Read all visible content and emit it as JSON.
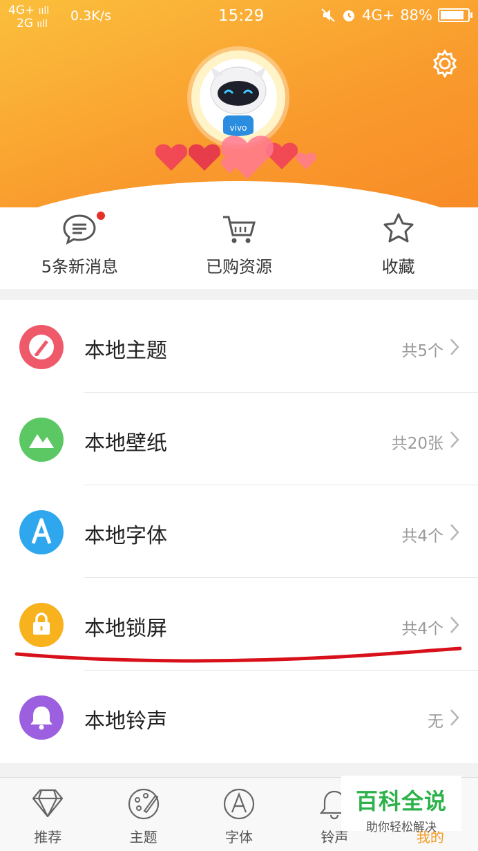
{
  "status_bar": {
    "signal_1": "4G+",
    "signal_2": "2G",
    "speed": "0.3K/s",
    "time": "15:29",
    "network": "4G+",
    "battery_text": "88%",
    "battery_level": 0.88
  },
  "header": {
    "avatar_text": "vivo"
  },
  "quick_actions": [
    {
      "label": "5条新消息"
    },
    {
      "label": "已购资源"
    },
    {
      "label": "收藏"
    }
  ],
  "local_items": [
    {
      "title": "本地主题",
      "count": "共5个",
      "color": "#ef5a6a"
    },
    {
      "title": "本地壁纸",
      "count": "共20张",
      "color": "#5cc864"
    },
    {
      "title": "本地字体",
      "count": "共4个",
      "color": "#2ea7ee"
    },
    {
      "title": "本地锁屏",
      "count": "共4个",
      "color": "#f7b21e"
    },
    {
      "title": "本地铃声",
      "count": "无",
      "color": "#9b5fe0"
    }
  ],
  "tabs": [
    {
      "label": "推荐"
    },
    {
      "label": "主题"
    },
    {
      "label": "字体"
    },
    {
      "label": "铃声"
    },
    {
      "label": "我的"
    }
  ],
  "watermark": {
    "title": "百科全说",
    "subtitle": "助你轻松解决"
  },
  "colors": {
    "accent": "#f39a20",
    "annotation_red": "#d8101a"
  }
}
